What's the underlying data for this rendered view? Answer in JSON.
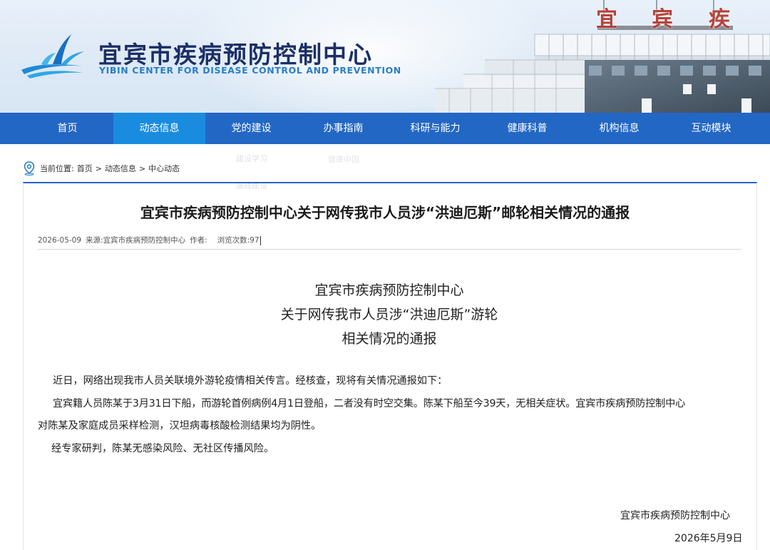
{
  "header": {
    "site_title": "宜宾市疾病预防控制中心",
    "site_subtitle": "YIBIN CENTER FOR DISEASE CONTROL AND PREVENTION",
    "building_sign": [
      "宜",
      "宾",
      "疾"
    ],
    "logo_icon": "cdc-logo-icon"
  },
  "nav": {
    "items": [
      {
        "label": "首页"
      },
      {
        "label": "动态信息"
      },
      {
        "label": "党的建设"
      },
      {
        "label": "办事指南"
      },
      {
        "label": "科研与能力"
      },
      {
        "label": "健康科普"
      },
      {
        "label": "机构信息"
      },
      {
        "label": "互动模块"
      }
    ],
    "active_index": 1,
    "dropdown": [
      "建设学习",
      "廉政建设"
    ],
    "dropdown2": [
      "健康中国"
    ]
  },
  "breadcrumb": {
    "icon": "location-pin-icon",
    "prefix": "当前位置:",
    "items": [
      "首页",
      "动态信息",
      "中心动态"
    ],
    "separator": ">"
  },
  "article": {
    "title": "宜宾市疾病预防控制中心关于网传我市人员涉“洪迪厄斯”邮轮相关情况的通报",
    "date": "2026-05-09",
    "source_label": "来源:",
    "source": "宜宾市疾病预防控制中心",
    "author_label": "作者:",
    "views_label": "浏览次数:",
    "views": "97",
    "heading_lines": [
      "宜宾市疾病预防控制中心",
      "关于网传我市人员涉“洪迪厄斯”游轮",
      "相关情况的通报"
    ],
    "paragraphs": [
      "近日，网络出现我市人员关联境外游轮疫情相关传言。经核查，现将有关情况通报如下：",
      "宜宾籍人员陈某于3月31日下船，而游轮首例病例4月1日登船，二者没有时空交集。陈某下船至今39天，无相关症状。宜宾市疾病预防控制中心",
      "对陈某及家庭成员采样检测，汉坦病毒核酸检测结果均为阴性。",
      "经专家研判，陈某无感染风险、无社区传播风险。"
    ],
    "signature": "宜宾市疾病预防控制中心",
    "sign_date": "2026年5月9日"
  },
  "colors": {
    "nav_bg": "#2367c5",
    "nav_active": "#1a8ce0",
    "title_blue": "#1b2f66",
    "subtitle_blue": "#2a7ec8"
  }
}
